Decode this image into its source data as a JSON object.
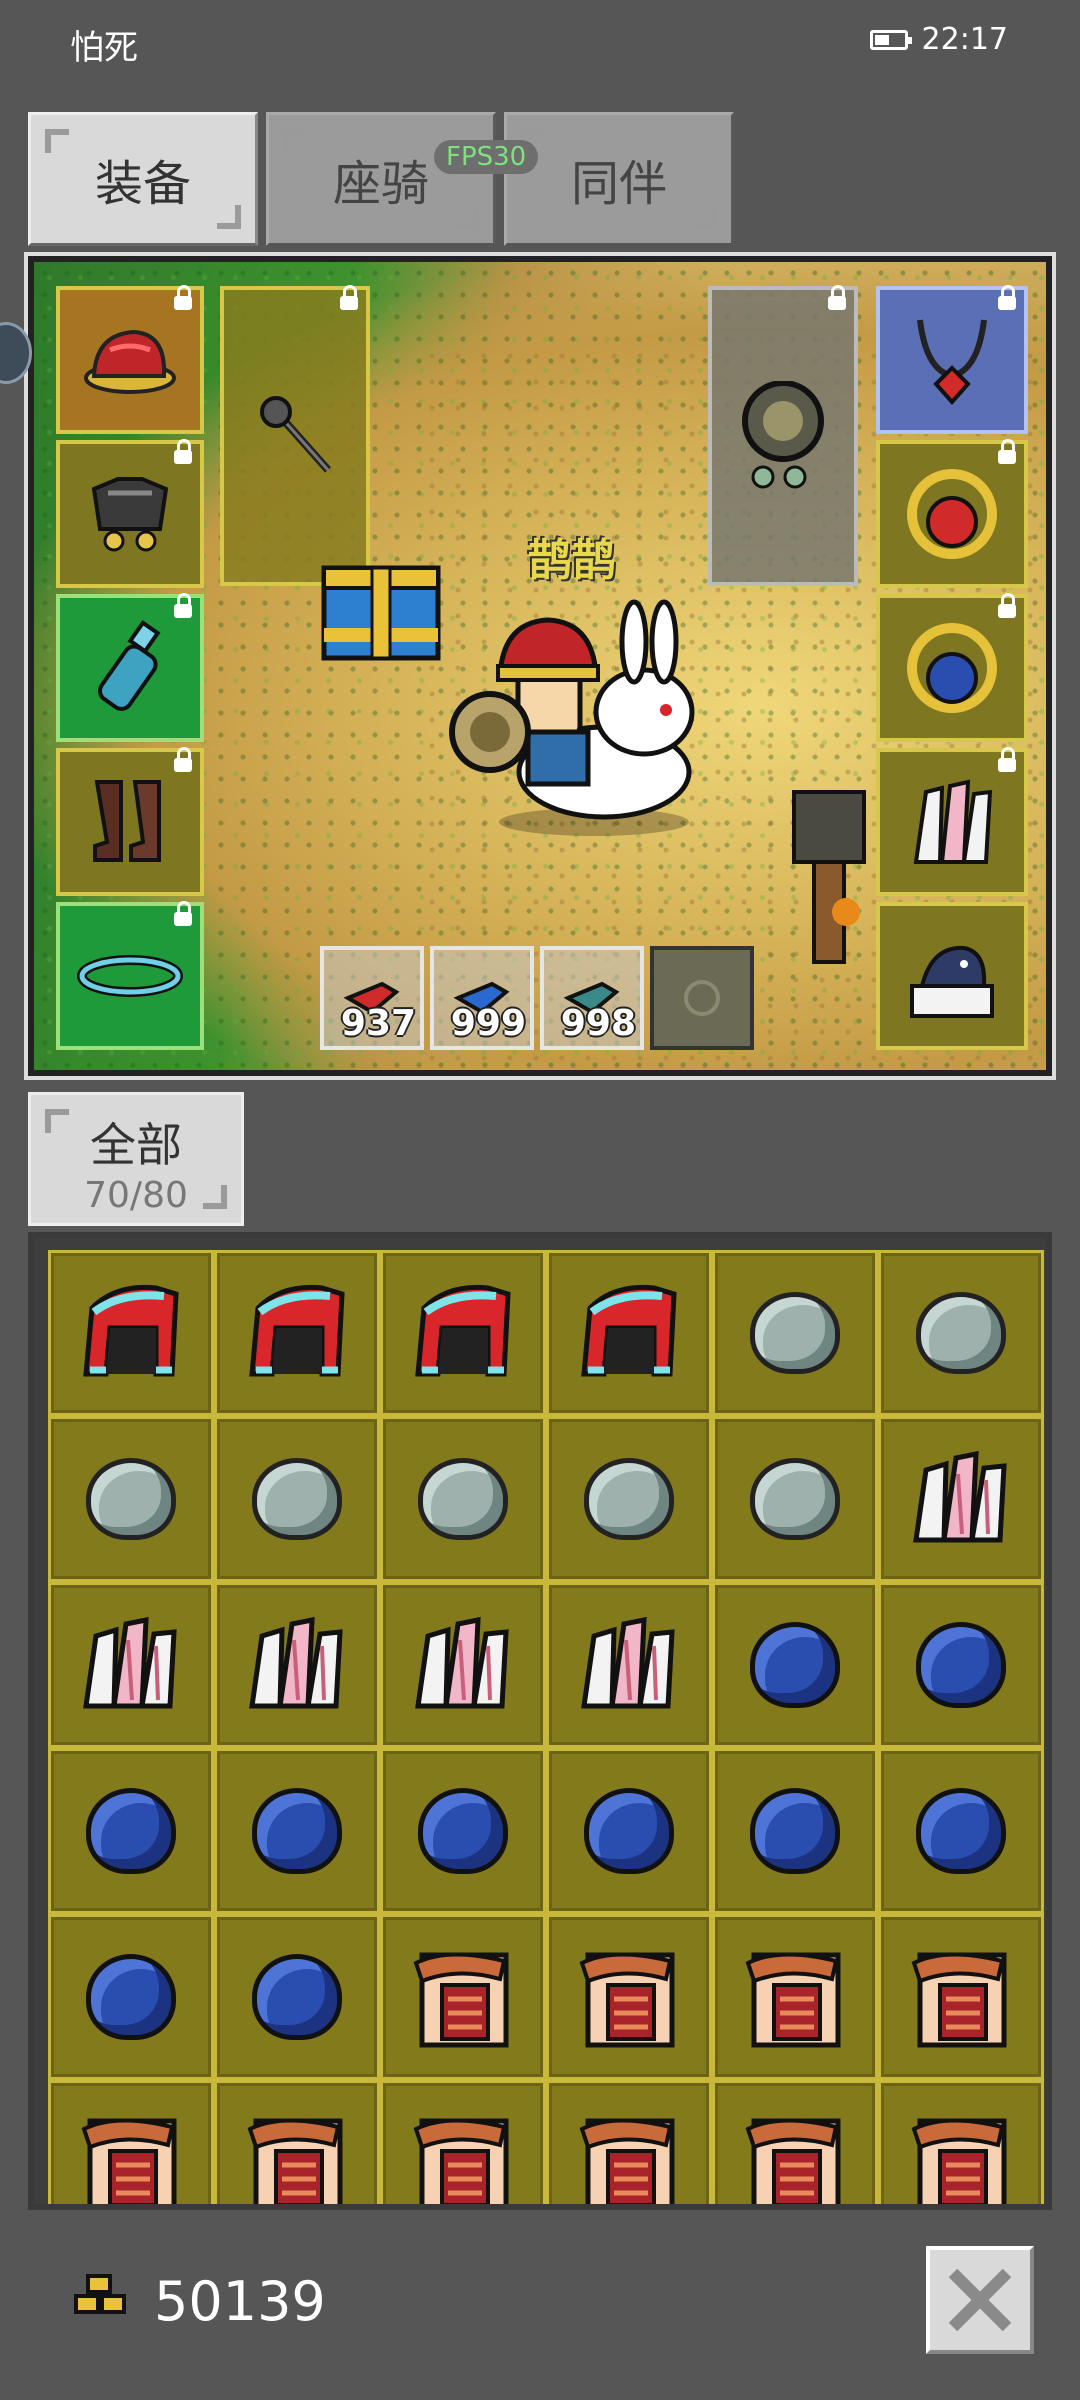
{
  "status_bar": {
    "app_name": "怕死",
    "time": "22:17"
  },
  "tabs": [
    {
      "label": "装备",
      "active": true
    },
    {
      "label": "座骑",
      "active": false
    },
    {
      "label": "同伴",
      "active": false
    }
  ],
  "fps_label": "FPS30",
  "scene": {
    "character_name": "鹊鹊",
    "left_slots": [
      {
        "icon": "red-hat-icon",
        "locked": true
      },
      {
        "icon": "armor-icon",
        "locked": true
      },
      {
        "icon": "bottle-icon",
        "locked": true
      },
      {
        "icon": "boots-icon",
        "locked": true
      },
      {
        "icon": "bracelet-icon",
        "locked": true
      }
    ],
    "weapon_slot": {
      "icon": "mace-icon",
      "locked": true
    },
    "shield_slot": {
      "icon": "shield-icon",
      "locked": true
    },
    "right_slots": [
      {
        "icon": "necklace-icon",
        "locked": true
      },
      {
        "icon": "ruby-ring-icon",
        "locked": true
      },
      {
        "icon": "sapphire-ring-icon",
        "locked": true
      },
      {
        "icon": "feather-icon",
        "locked": true
      },
      {
        "icon": "magpie-icon",
        "locked": false
      }
    ],
    "consumables": [
      {
        "icon": "red-potion-icon",
        "count": "937"
      },
      {
        "icon": "blue-potion-icon",
        "count": "999"
      },
      {
        "icon": "teal-potion-icon",
        "count": "998"
      },
      {
        "icon": "empty-slot-icon",
        "count": ""
      }
    ]
  },
  "filter": {
    "label": "全部",
    "count": "70/80"
  },
  "inventory": [
    "red-hat",
    "red-hat",
    "red-hat",
    "red-hat",
    "stone",
    "stone",
    "stone",
    "stone",
    "stone",
    "stone",
    "stone",
    "feather",
    "feather",
    "feather",
    "feather",
    "feather",
    "sapphire",
    "sapphire",
    "sapphire",
    "sapphire",
    "sapphire",
    "sapphire",
    "sapphire",
    "sapphire",
    "sapphire",
    "sapphire",
    "scroll",
    "scroll",
    "scroll",
    "scroll",
    "scroll",
    "scroll",
    "scroll",
    "scroll",
    "scroll",
    "scroll"
  ],
  "gold": "50139",
  "colors": {
    "background": "#565656",
    "slot_olive": "#837a1c",
    "slot_border": "#c9b93b"
  }
}
